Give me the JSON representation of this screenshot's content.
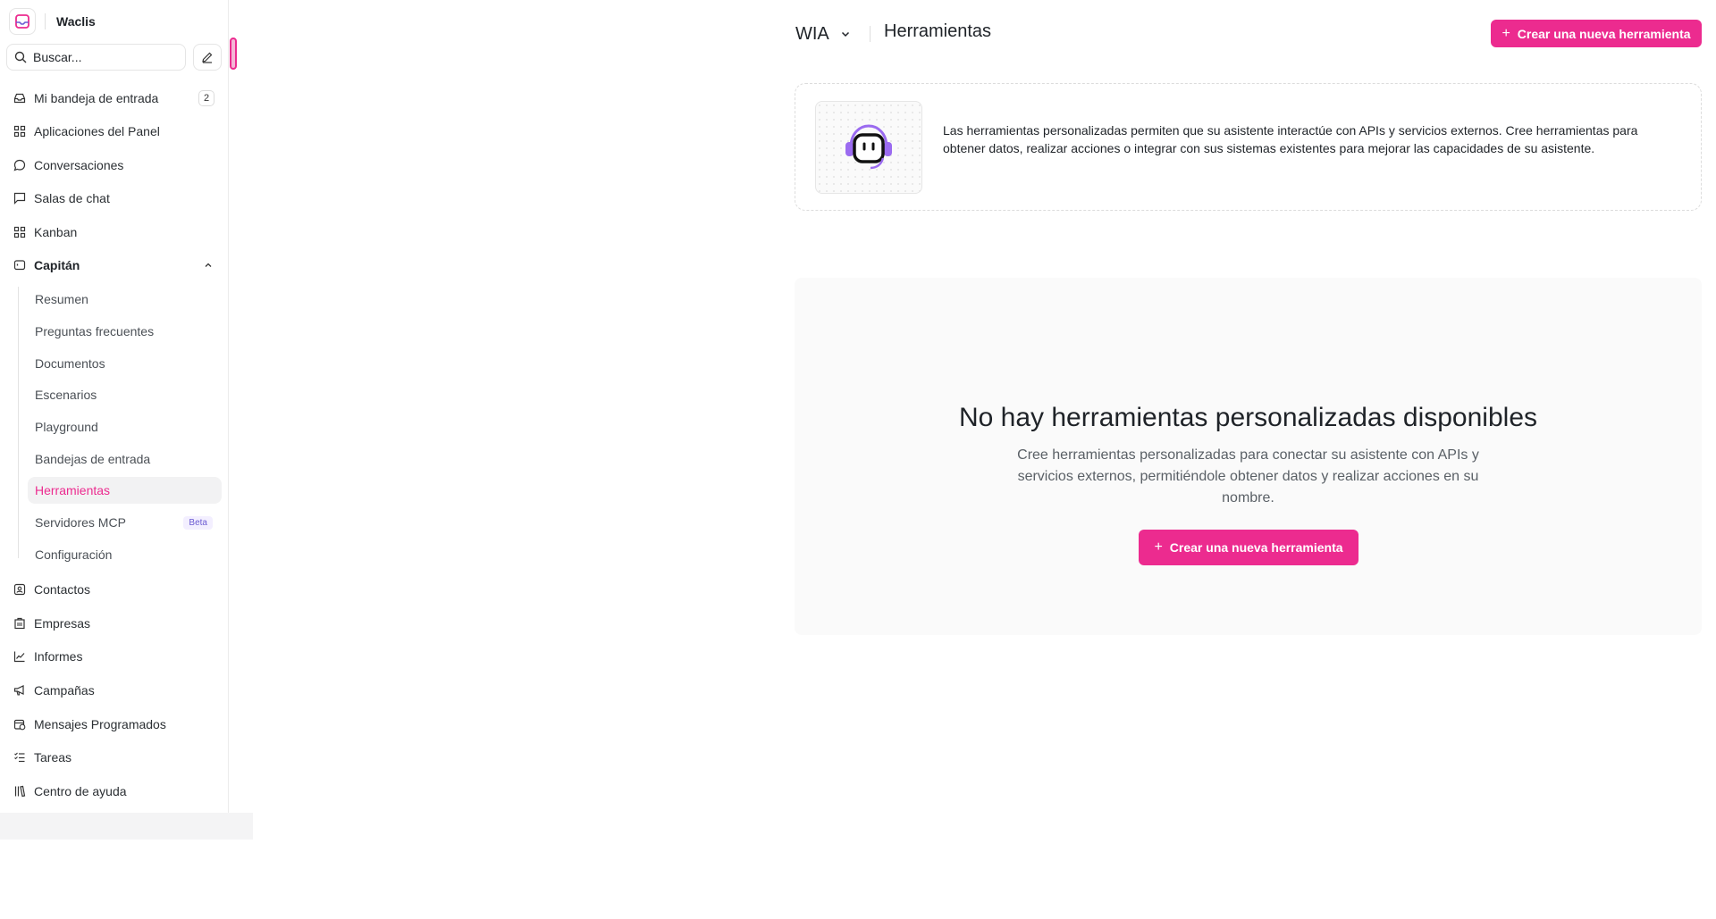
{
  "brand": {
    "name": "Waclis"
  },
  "search": {
    "placeholder": "Buscar..."
  },
  "nav": {
    "inbox": {
      "label": "Mi bandeja de entrada",
      "count": "2"
    },
    "dashboard_apps": "Aplicaciones del Panel",
    "conversations": "Conversaciones",
    "chat_rooms": "Salas de chat",
    "kanban": "Kanban",
    "captain": {
      "label": "Capitán",
      "items": [
        {
          "label": "Resumen"
        },
        {
          "label": "Preguntas frecuentes"
        },
        {
          "label": "Documentos"
        },
        {
          "label": "Escenarios"
        },
        {
          "label": "Playground"
        },
        {
          "label": "Bandejas de entrada"
        },
        {
          "label": "Herramientas"
        },
        {
          "label": "Servidores MCP",
          "badge": "Beta"
        },
        {
          "label": "Configuración"
        }
      ]
    },
    "contacts": "Contactos",
    "companies": "Empresas",
    "reports": "Informes",
    "campaigns": "Campañas",
    "scheduled_messages": "Mensajes Programados",
    "tasks": "Tareas",
    "help_center": "Centro de ayuda"
  },
  "header": {
    "workspace": "WIA",
    "title": "Herramientas",
    "create_button": "Crear una nueva herramienta"
  },
  "info": {
    "text": "Las herramientas personalizadas permiten que su asistente interactúe con APIs y servicios externos. Cree herramientas para obtener datos, realizar acciones o integrar con sus sistemas existentes para mejorar las capacidades de su asistente."
  },
  "empty_state": {
    "title": "No hay herramientas personalizadas disponibles",
    "description": "Cree herramientas personalizadas para conectar su asistente con APIs y servicios externos, permitiéndole obtener datos y realizar acciones en su nombre.",
    "button": "Crear una nueva herramienta"
  },
  "colors": {
    "accent": "#ec2b8f",
    "illustration": "#9b6bf0"
  }
}
